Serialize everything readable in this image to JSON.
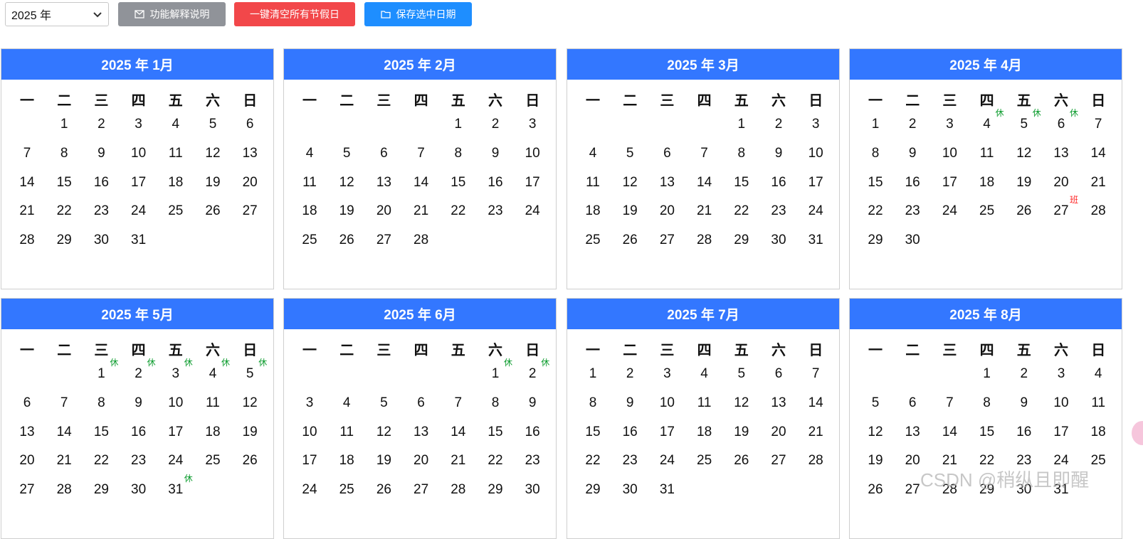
{
  "toolbar": {
    "year_value": "2025 年",
    "help_label": "功能解释说明",
    "clear_label": "一键清空所有节假日",
    "save_label": "保存选中日期"
  },
  "weekday_labels": [
    "一",
    "二",
    "三",
    "四",
    "五",
    "六",
    "日"
  ],
  "rest_mark": "休",
  "work_mark": "班",
  "months": [
    {
      "title": "2025 年 1月",
      "first_weekday": 2,
      "days": 31,
      "marks": {}
    },
    {
      "title": "2025 年 2月",
      "first_weekday": 5,
      "days": 28,
      "marks": {}
    },
    {
      "title": "2025 年 3月",
      "first_weekday": 5,
      "days": 31,
      "marks": {}
    },
    {
      "title": "2025 年 4月",
      "first_weekday": 1,
      "days": 30,
      "marks": {
        "4": "rest",
        "5": "rest",
        "6": "rest",
        "27": "work"
      }
    },
    {
      "title": "2025 年 5月",
      "first_weekday": 3,
      "days": 31,
      "marks": {
        "1": "rest",
        "2": "rest",
        "3": "rest",
        "4": "rest",
        "5": "rest",
        "31": "rest"
      }
    },
    {
      "title": "2025 年 6月",
      "first_weekday": 6,
      "days": 30,
      "marks": {
        "1": "rest",
        "2": "rest"
      }
    },
    {
      "title": "2025 年 7月",
      "first_weekday": 1,
      "days": 31,
      "marks": {}
    },
    {
      "title": "2025 年 8月",
      "first_weekday": 4,
      "days": 31,
      "marks": {}
    }
  ],
  "watermark": "CSDN @稍纵且即醒",
  "colors": {
    "header_blue": "#3377ff",
    "rest_green": "#0a9b2c",
    "work_red": "#f22",
    "help_gray": "#909399",
    "clear_red": "#f2474a",
    "save_blue": "#1e8eff"
  }
}
